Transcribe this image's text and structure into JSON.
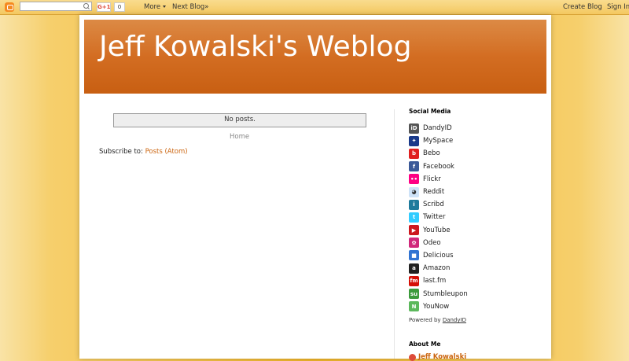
{
  "navbar": {
    "gplus_label": "G+1",
    "gplus_count": "0",
    "more_label": "More",
    "next_blog_label": "Next Blog»",
    "create_blog_label": "Create Blog",
    "sign_in_label": "Sign In"
  },
  "header": {
    "title": "Jeff Kowalski's Weblog"
  },
  "main": {
    "no_posts": "No posts.",
    "home_link": "Home",
    "subscribe_label": "Subscribe to:",
    "subscribe_link": "Posts (Atom)"
  },
  "sidebar": {
    "social_heading": "Social Media",
    "social_items": [
      {
        "label": "DandyID",
        "icon": "dandyid-icon",
        "color": "#555555"
      },
      {
        "label": "MySpace",
        "icon": "myspace-icon",
        "color": "#1a3a8a"
      },
      {
        "label": "Bebo",
        "icon": "bebo-icon",
        "color": "#e02020"
      },
      {
        "label": "Facebook",
        "icon": "facebook-icon",
        "color": "#3b5998"
      },
      {
        "label": "Flickr",
        "icon": "flickr-icon",
        "color": "#ff0084"
      },
      {
        "label": "Reddit",
        "icon": "reddit-icon",
        "color": "#cee3f8"
      },
      {
        "label": "Scribd",
        "icon": "scribd-icon",
        "color": "#1e7b9c"
      },
      {
        "label": "Twitter",
        "icon": "twitter-icon",
        "color": "#33ccff"
      },
      {
        "label": "YouTube",
        "icon": "youtube-icon",
        "color": "#cc181e"
      },
      {
        "label": "Odeo",
        "icon": "odeo-icon",
        "color": "#d0287a"
      },
      {
        "label": "Delicious",
        "icon": "delicious-icon",
        "color": "#3274d2"
      },
      {
        "label": "Amazon",
        "icon": "amazon-icon",
        "color": "#222222"
      },
      {
        "label": "last.fm",
        "icon": "lastfm-icon",
        "color": "#d51007"
      },
      {
        "label": "Stumbleupon",
        "icon": "stumbleupon-icon",
        "color": "#3c9b3c"
      },
      {
        "label": "YouNow",
        "icon": "younow-icon",
        "color": "#5cb85c"
      }
    ],
    "powered_by_label": "Powered by",
    "powered_by_link": "DandyID",
    "about_heading": "About Me",
    "about_name": "Jeff Kowalski"
  }
}
